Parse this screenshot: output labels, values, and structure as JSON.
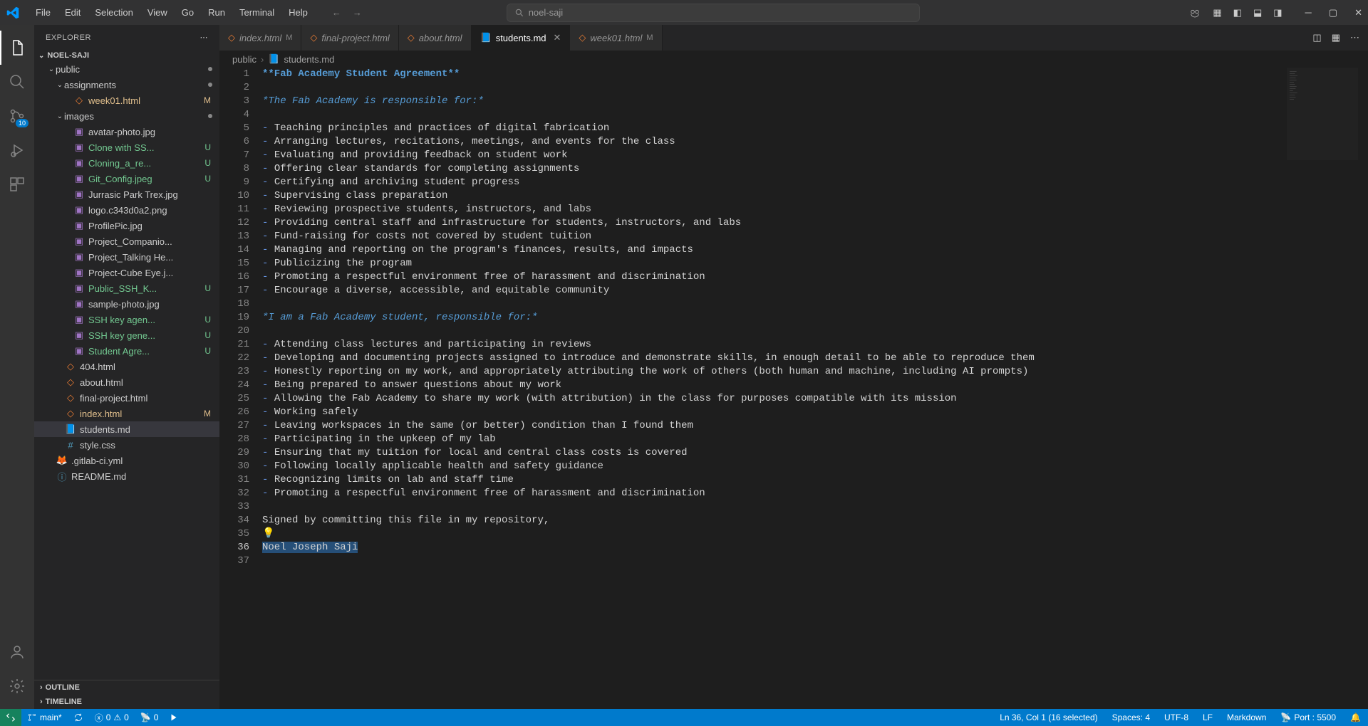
{
  "menu": [
    "File",
    "Edit",
    "Selection",
    "View",
    "Go",
    "Run",
    "Terminal",
    "Help"
  ],
  "search_label": "noel-saji",
  "scm_badge": "10",
  "sidebar": {
    "title": "EXPLORER",
    "root": "NOEL-SAJI",
    "sections_bottom": [
      "OUTLINE",
      "TIMELINE"
    ],
    "tree": [
      {
        "type": "folder",
        "label": "public",
        "indent": 1,
        "open": true,
        "dot": true
      },
      {
        "type": "folder",
        "label": "assignments",
        "indent": 2,
        "open": true,
        "dot": true
      },
      {
        "type": "file",
        "label": "week01.html",
        "indent": 3,
        "icon": "html",
        "status": "M",
        "cls": "mod"
      },
      {
        "type": "folder",
        "label": "images",
        "indent": 2,
        "open": true,
        "dot": true
      },
      {
        "type": "file",
        "label": "avatar-photo.jpg",
        "indent": 3,
        "icon": "img"
      },
      {
        "type": "file",
        "label": "Clone with SS...",
        "indent": 3,
        "icon": "img",
        "status": "U",
        "cls": "untracked"
      },
      {
        "type": "file",
        "label": "Cloning_a_re...",
        "indent": 3,
        "icon": "img",
        "status": "U",
        "cls": "untracked"
      },
      {
        "type": "file",
        "label": "Git_Config.jpeg",
        "indent": 3,
        "icon": "img",
        "status": "U",
        "cls": "untracked"
      },
      {
        "type": "file",
        "label": "Jurrasic Park Trex.jpg",
        "indent": 3,
        "icon": "img"
      },
      {
        "type": "file",
        "label": "logo.c343d0a2.png",
        "indent": 3,
        "icon": "img"
      },
      {
        "type": "file",
        "label": "ProfilePic.jpg",
        "indent": 3,
        "icon": "img"
      },
      {
        "type": "file",
        "label": "Project_Companio...",
        "indent": 3,
        "icon": "img"
      },
      {
        "type": "file",
        "label": "Project_Talking He...",
        "indent": 3,
        "icon": "img"
      },
      {
        "type": "file",
        "label": "Project-Cube Eye.j...",
        "indent": 3,
        "icon": "img"
      },
      {
        "type": "file",
        "label": "Public_SSH_K...",
        "indent": 3,
        "icon": "img",
        "status": "U",
        "cls": "untracked"
      },
      {
        "type": "file",
        "label": "sample-photo.jpg",
        "indent": 3,
        "icon": "img"
      },
      {
        "type": "file",
        "label": "SSH key agen...",
        "indent": 3,
        "icon": "img",
        "status": "U",
        "cls": "untracked"
      },
      {
        "type": "file",
        "label": "SSH key gene...",
        "indent": 3,
        "icon": "img",
        "status": "U",
        "cls": "untracked"
      },
      {
        "type": "file",
        "label": "Student Agre...",
        "indent": 3,
        "icon": "img",
        "status": "U",
        "cls": "untracked"
      },
      {
        "type": "file",
        "label": "404.html",
        "indent": 2,
        "icon": "html"
      },
      {
        "type": "file",
        "label": "about.html",
        "indent": 2,
        "icon": "html"
      },
      {
        "type": "file",
        "label": "final-project.html",
        "indent": 2,
        "icon": "html"
      },
      {
        "type": "file",
        "label": "index.html",
        "indent": 2,
        "icon": "html",
        "status": "M",
        "cls": "mod"
      },
      {
        "type": "file",
        "label": "students.md",
        "indent": 2,
        "icon": "md",
        "selected": true
      },
      {
        "type": "file",
        "label": "style.css",
        "indent": 2,
        "icon": "css"
      },
      {
        "type": "file",
        "label": ".gitlab-ci.yml",
        "indent": 1,
        "icon": "yml"
      },
      {
        "type": "file",
        "label": "README.md",
        "indent": 1,
        "icon": "info"
      }
    ]
  },
  "tabs": [
    {
      "label": "index.html",
      "icon": "html",
      "status": "M"
    },
    {
      "label": "final-project.html",
      "icon": "html"
    },
    {
      "label": "about.html",
      "icon": "html"
    },
    {
      "label": "students.md",
      "icon": "md",
      "active": true,
      "close": true
    },
    {
      "label": "week01.html",
      "icon": "html",
      "status": "M"
    }
  ],
  "breadcrumb": [
    "public",
    "students.md"
  ],
  "editor_lines": [
    {
      "n": 1,
      "parts": [
        {
          "cls": "md-bold",
          "t": "**Fab Academy Student Agreement**"
        }
      ]
    },
    {
      "n": 2,
      "parts": []
    },
    {
      "n": 3,
      "parts": [
        {
          "cls": "md-italic",
          "t": "*The Fab Academy is responsible for:*"
        }
      ]
    },
    {
      "n": 4,
      "parts": []
    },
    {
      "n": 5,
      "parts": [
        {
          "cls": "md-list",
          "t": "- "
        },
        {
          "cls": "md-text",
          "t": "Teaching principles and practices of digital fabrication"
        }
      ]
    },
    {
      "n": 6,
      "parts": [
        {
          "cls": "md-list",
          "t": "- "
        },
        {
          "cls": "md-text",
          "t": "Arranging lectures, recitations, meetings, and events for the class"
        }
      ]
    },
    {
      "n": 7,
      "parts": [
        {
          "cls": "md-list",
          "t": "- "
        },
        {
          "cls": "md-text",
          "t": "Evaluating and providing feedback on student work"
        }
      ]
    },
    {
      "n": 8,
      "parts": [
        {
          "cls": "md-list",
          "t": "- "
        },
        {
          "cls": "md-text",
          "t": "Offering clear standards for completing assignments"
        }
      ]
    },
    {
      "n": 9,
      "parts": [
        {
          "cls": "md-list",
          "t": "- "
        },
        {
          "cls": "md-text",
          "t": "Certifying and archiving student progress"
        }
      ]
    },
    {
      "n": 10,
      "parts": [
        {
          "cls": "md-list",
          "t": "- "
        },
        {
          "cls": "md-text",
          "t": "Supervising class preparation"
        }
      ]
    },
    {
      "n": 11,
      "parts": [
        {
          "cls": "md-list",
          "t": "- "
        },
        {
          "cls": "md-text",
          "t": "Reviewing prospective students, instructors, and labs"
        }
      ]
    },
    {
      "n": 12,
      "parts": [
        {
          "cls": "md-list",
          "t": "- "
        },
        {
          "cls": "md-text",
          "t": "Providing central staff and infrastructure for students, instructors, and labs"
        }
      ]
    },
    {
      "n": 13,
      "parts": [
        {
          "cls": "md-list",
          "t": "- "
        },
        {
          "cls": "md-text",
          "t": "Fund-raising for costs not covered by student tuition"
        }
      ]
    },
    {
      "n": 14,
      "parts": [
        {
          "cls": "md-list",
          "t": "- "
        },
        {
          "cls": "md-text",
          "t": "Managing and reporting on the program's finances, results, and impacts"
        }
      ]
    },
    {
      "n": 15,
      "parts": [
        {
          "cls": "md-list",
          "t": "- "
        },
        {
          "cls": "md-text",
          "t": "Publicizing the program"
        }
      ]
    },
    {
      "n": 16,
      "parts": [
        {
          "cls": "md-list",
          "t": "- "
        },
        {
          "cls": "md-text",
          "t": "Promoting a respectful environment free of harassment and discrimination"
        }
      ]
    },
    {
      "n": 17,
      "parts": [
        {
          "cls": "md-list",
          "t": "- "
        },
        {
          "cls": "md-text",
          "t": "Encourage a diverse, accessible, and equitable community"
        }
      ]
    },
    {
      "n": 18,
      "parts": []
    },
    {
      "n": 19,
      "parts": [
        {
          "cls": "md-italic",
          "t": "*I am a Fab Academy student, responsible for:*"
        }
      ]
    },
    {
      "n": 20,
      "parts": []
    },
    {
      "n": 21,
      "parts": [
        {
          "cls": "md-list",
          "t": "- "
        },
        {
          "cls": "md-text",
          "t": "Attending class lectures and participating in reviews"
        }
      ]
    },
    {
      "n": 22,
      "parts": [
        {
          "cls": "md-list",
          "t": "- "
        },
        {
          "cls": "md-text",
          "t": "Developing and documenting projects assigned to introduce and demonstrate skills, in enough detail to be able to reproduce them"
        }
      ]
    },
    {
      "n": 23,
      "parts": [
        {
          "cls": "md-list",
          "t": "- "
        },
        {
          "cls": "md-text",
          "t": "Honestly reporting on my work, and appropriately attributing the work of others (both human and machine, including AI prompts)"
        }
      ]
    },
    {
      "n": 24,
      "parts": [
        {
          "cls": "md-list",
          "t": "- "
        },
        {
          "cls": "md-text",
          "t": "Being prepared to answer questions about my work"
        }
      ]
    },
    {
      "n": 25,
      "parts": [
        {
          "cls": "md-list",
          "t": "- "
        },
        {
          "cls": "md-text",
          "t": "Allowing the Fab Academy to share my work (with attribution) in the class for purposes compatible with its mission"
        }
      ]
    },
    {
      "n": 26,
      "parts": [
        {
          "cls": "md-list",
          "t": "- "
        },
        {
          "cls": "md-text",
          "t": "Working safely"
        }
      ]
    },
    {
      "n": 27,
      "parts": [
        {
          "cls": "md-list",
          "t": "- "
        },
        {
          "cls": "md-text",
          "t": "Leaving workspaces in the same (or better) condition than I found them"
        }
      ]
    },
    {
      "n": 28,
      "parts": [
        {
          "cls": "md-list",
          "t": "- "
        },
        {
          "cls": "md-text",
          "t": "Participating in the upkeep of my lab"
        }
      ]
    },
    {
      "n": 29,
      "parts": [
        {
          "cls": "md-list",
          "t": "- "
        },
        {
          "cls": "md-text",
          "t": "Ensuring that my tuition for local and central class costs is covered"
        }
      ]
    },
    {
      "n": 30,
      "parts": [
        {
          "cls": "md-list",
          "t": "- "
        },
        {
          "cls": "md-text",
          "t": "Following locally applicable health and safety guidance"
        }
      ]
    },
    {
      "n": 31,
      "parts": [
        {
          "cls": "md-list",
          "t": "- "
        },
        {
          "cls": "md-text",
          "t": "Recognizing limits on lab and staff time"
        }
      ]
    },
    {
      "n": 32,
      "parts": [
        {
          "cls": "md-list",
          "t": "- "
        },
        {
          "cls": "md-text",
          "t": "Promoting a respectful environment free of harassment and discrimination"
        }
      ]
    },
    {
      "n": 33,
      "parts": []
    },
    {
      "n": 34,
      "parts": [
        {
          "cls": "md-text",
          "t": "Signed by committing this file in my repository,"
        }
      ]
    },
    {
      "n": 35,
      "parts": [
        {
          "cls": "bulb",
          "t": "💡"
        }
      ],
      "bulb": true
    },
    {
      "n": 36,
      "parts": [
        {
          "cls": "md-text selection",
          "t": "Noel Joseph Saji"
        }
      ],
      "active": true
    },
    {
      "n": 37,
      "parts": []
    }
  ],
  "status": {
    "branch": "main*",
    "errors": "0",
    "warnings": "0",
    "ports": "0",
    "cursor": "Ln 36, Col 1 (16 selected)",
    "spaces": "Spaces: 4",
    "encoding": "UTF-8",
    "eol": "LF",
    "language": "Markdown",
    "port": "Port : 5500"
  }
}
